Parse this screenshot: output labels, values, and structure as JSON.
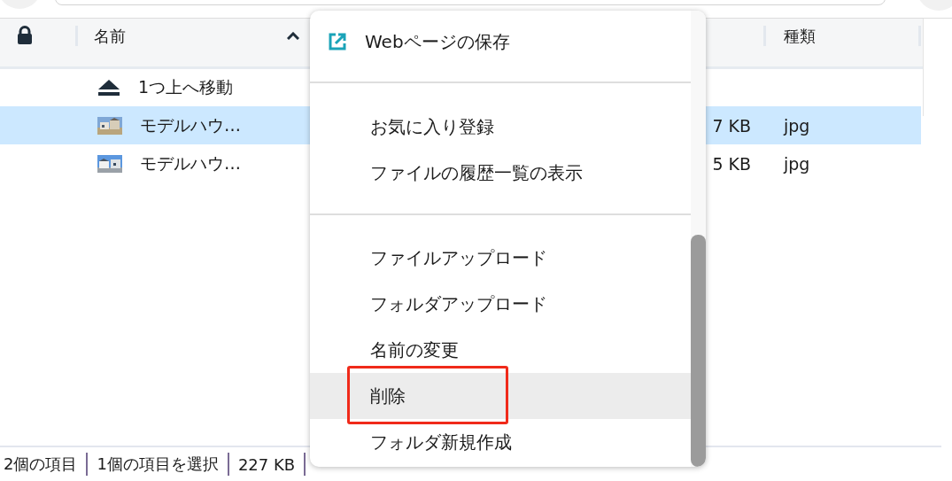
{
  "table": {
    "columns": [
      {
        "kind": "lock"
      },
      {
        "kind": "name",
        "label": "名前",
        "sorted": true
      },
      {
        "kind": "size"
      },
      {
        "kind": "type",
        "label": "種類"
      }
    ],
    "rows": [
      {
        "kind": "parent",
        "name": "1つ上へ移動",
        "selected": false
      },
      {
        "kind": "file",
        "name": "モデルハウ…",
        "size": "7 KB",
        "type": "jpg",
        "selected": true
      },
      {
        "kind": "file",
        "name": "モデルハウ…",
        "size": "5 KB",
        "type": "jpg",
        "selected": false
      }
    ]
  },
  "context_menu": {
    "items": [
      {
        "kind": "icon_action",
        "label": "Webページの保存",
        "hovered": false
      },
      {
        "kind": "divider"
      },
      {
        "kind": "action",
        "label": "お気に入り登録",
        "hovered": false
      },
      {
        "kind": "action",
        "label": "ファイルの履歴一覧の表示",
        "hovered": false
      },
      {
        "kind": "divider"
      },
      {
        "kind": "action",
        "label": "ファイルアップロード",
        "hovered": false
      },
      {
        "kind": "action",
        "label": "フォルダアップロード",
        "hovered": false
      },
      {
        "kind": "action",
        "label": "名前の変更",
        "hovered": false
      },
      {
        "kind": "action",
        "label": "削除",
        "hovered": true,
        "outlined": true
      },
      {
        "kind": "action",
        "label": "フォルダ新規作成",
        "hovered": false
      }
    ]
  },
  "status_bar": {
    "items": [
      "2個の項目",
      "1個の項目を選択",
      "227 KB"
    ]
  }
}
